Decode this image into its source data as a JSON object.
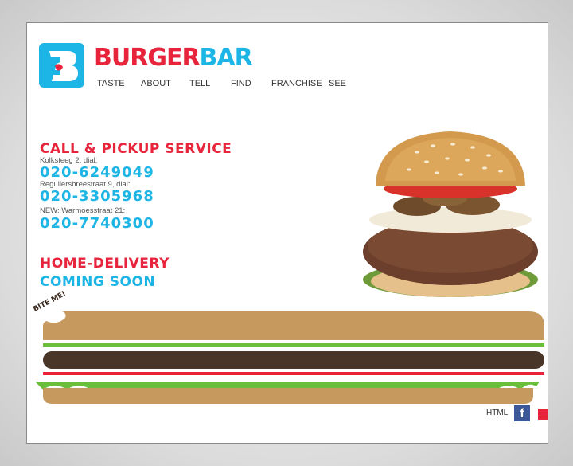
{
  "brand": {
    "name_part1": "BURGER",
    "name_part2": "BAR",
    "logo_letter": "B"
  },
  "nav": {
    "items": [
      {
        "label": "TASTE"
      },
      {
        "label": "ABOUT"
      },
      {
        "label": "TELL"
      },
      {
        "label": "FIND"
      },
      {
        "label": "FRANCHISE"
      },
      {
        "label": "SEE"
      }
    ]
  },
  "pickup": {
    "heading": "CALL & PICKUP SERVICE",
    "locations": [
      {
        "address": "Kolksteeg 2, dial:",
        "phone": "020-6249049"
      },
      {
        "address": "Reguliersbreestraat 9, dial:",
        "phone": "020-3305968"
      },
      {
        "address": "NEW: Warmoesstraat 21:",
        "phone": "020-7740300"
      }
    ]
  },
  "delivery": {
    "line1": "HOME-DELIVERY",
    "line2": "COMING SOON"
  },
  "bite_label": "BITE ME!",
  "footer": {
    "html_label": "HTML",
    "facebook_label": "f"
  },
  "colors": {
    "brand_red": "#e8243c",
    "brand_blue": "#1db5e6",
    "bun": "#c69a5e",
    "lettuce_green": "#6abf3a",
    "patty": "#4a3628"
  },
  "icons": [
    "burgerbar-logo-icon",
    "burger-photo-icon",
    "facebook-icon"
  ]
}
